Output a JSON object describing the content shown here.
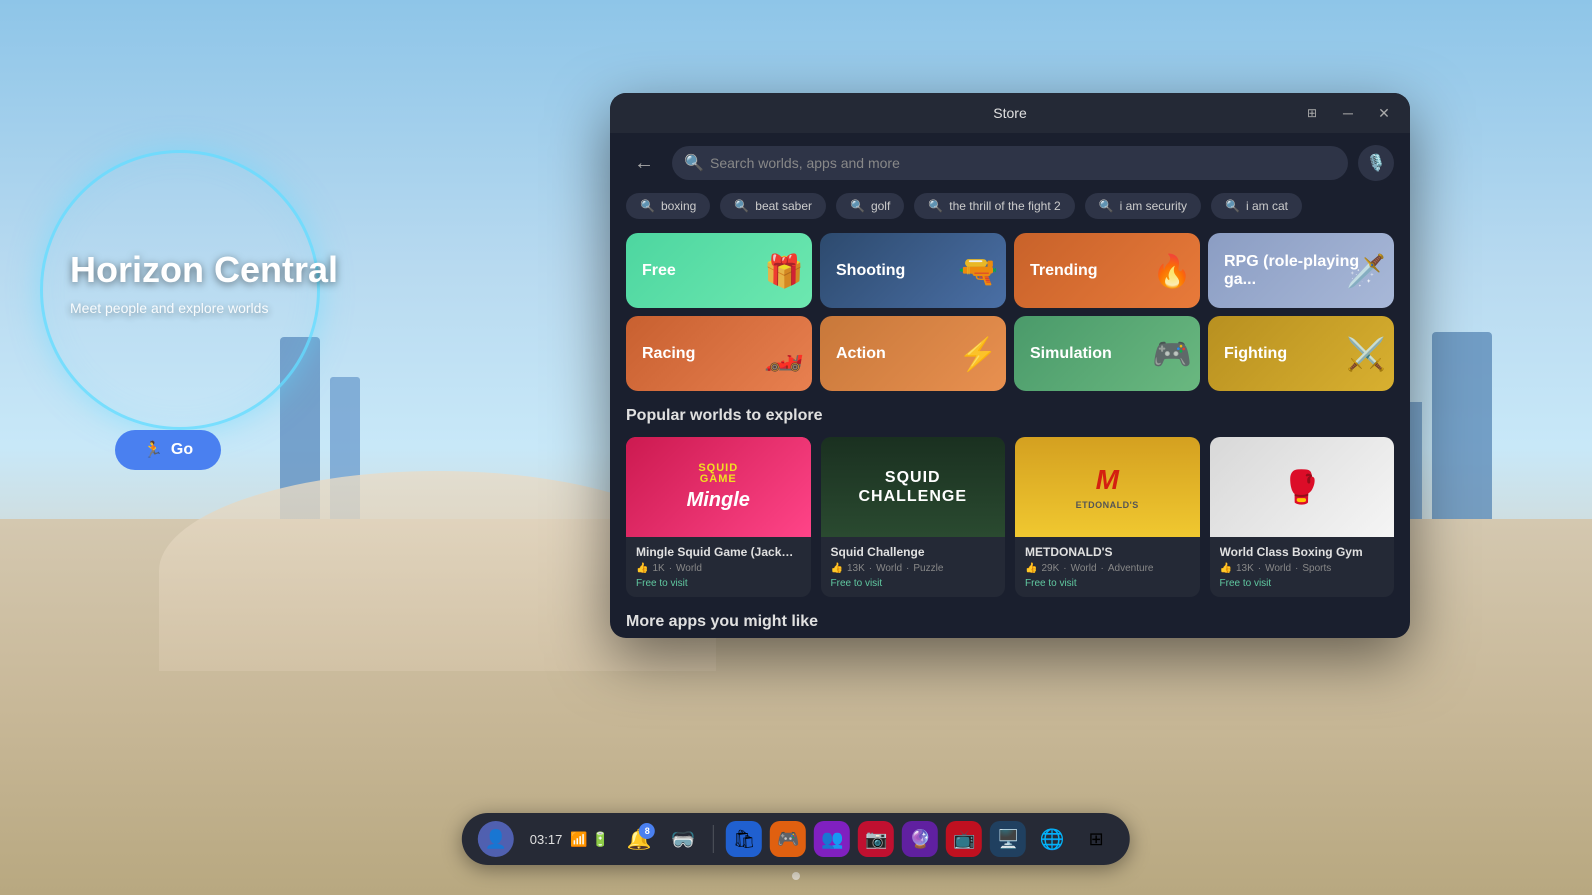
{
  "background": {
    "description": "VR environment with futuristic city"
  },
  "horizon_central": {
    "title": "Horizon\nCentral",
    "subtitle": "Meet people\nand explore worlds",
    "go_button": "Go"
  },
  "store_window": {
    "title": "Store",
    "search_placeholder": "Search worlds, apps and more",
    "suggestions": [
      {
        "label": "boxing"
      },
      {
        "label": "beat saber"
      },
      {
        "label": "golf"
      },
      {
        "label": "the thrill of the fight 2"
      },
      {
        "label": "i am security"
      },
      {
        "label": "i am cat"
      }
    ],
    "categories": [
      {
        "id": "free",
        "label": "Free",
        "icon": "🎁",
        "style": "cat-free"
      },
      {
        "id": "shooting",
        "label": "Shooting",
        "icon": "🔫",
        "style": "cat-shooting"
      },
      {
        "id": "trending",
        "label": "Trending",
        "icon": "🔥",
        "style": "cat-trending"
      },
      {
        "id": "rpg",
        "label": "RPG (role-playing ga...",
        "icon": "🗡️",
        "style": "cat-rpg"
      },
      {
        "id": "racing",
        "label": "Racing",
        "icon": "🏎️",
        "style": "cat-racing"
      },
      {
        "id": "action",
        "label": "Action",
        "icon": "⚡",
        "style": "cat-action"
      },
      {
        "id": "simulation",
        "label": "Simulation",
        "icon": "🎮",
        "style": "cat-simulation"
      },
      {
        "id": "fighting",
        "label": "Fighting",
        "icon": "⚔️",
        "style": "cat-fighting"
      }
    ],
    "popular_section": "Popular worlds to explore",
    "worlds": [
      {
        "id": "mingle-squid",
        "name": "Mingle Squid Game (Jackpot ...",
        "likes": "1K",
        "type": "World",
        "price": "Free to visit",
        "thumb_type": "squid"
      },
      {
        "id": "squid-challenge",
        "name": "Squid Challenge",
        "likes": "13K",
        "type": "World",
        "category": "Puzzle",
        "price": "Free to visit",
        "thumb_type": "squid-challenge"
      },
      {
        "id": "metdonald",
        "name": "METDONALD'S",
        "likes": "29K",
        "type": "World",
        "category": "Adventure",
        "price": "Free to visit",
        "thumb_type": "mcdonald"
      },
      {
        "id": "boxing-gym",
        "name": "World Class Boxing Gym",
        "likes": "13K",
        "type": "World",
        "category": "Sports",
        "price": "Free to visit",
        "thumb_type": "boxing"
      }
    ],
    "more_section": "More apps you might like"
  },
  "taskbar": {
    "time": "03:17",
    "notification_count": "8",
    "icons": [
      {
        "id": "avatar",
        "emoji": "🟣"
      },
      {
        "id": "notification",
        "emoji": "🔔"
      },
      {
        "id": "vr-headset",
        "emoji": "🥽"
      },
      {
        "id": "store",
        "emoji": "🛍️"
      },
      {
        "id": "games",
        "emoji": "🎮"
      },
      {
        "id": "people",
        "emoji": "👥"
      },
      {
        "id": "camera",
        "emoji": "📷"
      },
      {
        "id": "purple-app",
        "emoji": "💜"
      },
      {
        "id": "red-app",
        "emoji": "📺"
      },
      {
        "id": "monitor",
        "emoji": "🖥️"
      },
      {
        "id": "globe",
        "emoji": "🌐"
      },
      {
        "id": "grid",
        "emoji": "⊞"
      },
      {
        "id": "wifi",
        "emoji": "📶"
      },
      {
        "id": "battery",
        "emoji": "🔋"
      }
    ]
  }
}
